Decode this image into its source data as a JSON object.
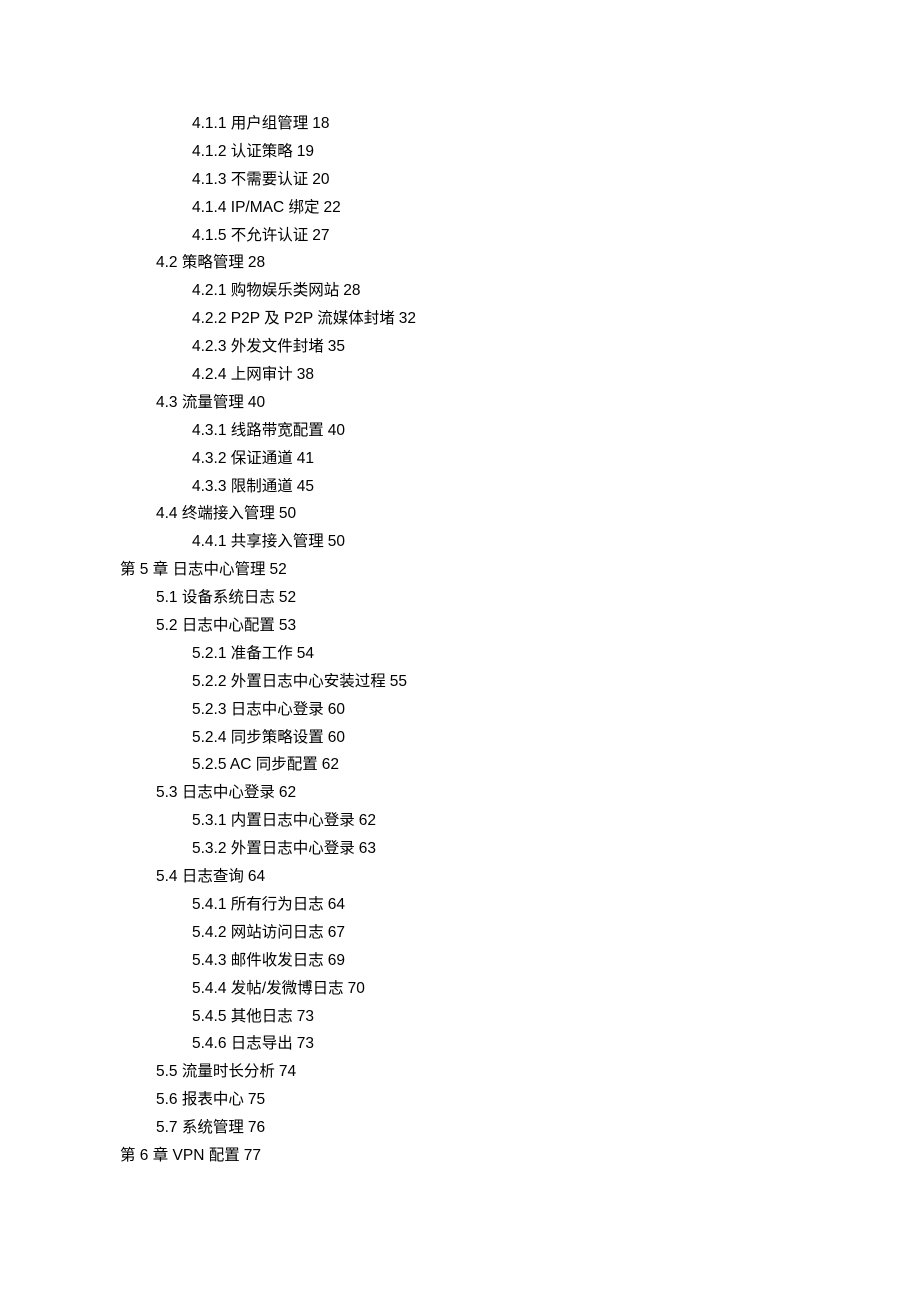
{
  "toc": {
    "entries": [
      {
        "level": 2,
        "label": "4.1.1 用户组管理",
        "page": "18"
      },
      {
        "level": 2,
        "label": "4.1.2 认证策略",
        "page": "19"
      },
      {
        "level": 2,
        "label": "4.1.3 不需要认证",
        "page": "20"
      },
      {
        "level": 2,
        "label": "4.1.4 IP/MAC 绑定",
        "page": "22"
      },
      {
        "level": 2,
        "label": "4.1.5 不允许认证",
        "page": "27"
      },
      {
        "level": 1,
        "label": "4.2 策略管理",
        "page": "28"
      },
      {
        "level": 2,
        "label": "4.2.1 购物娱乐类网站",
        "page": "28"
      },
      {
        "level": 2,
        "label": "4.2.2 P2P 及 P2P 流媒体封堵",
        "page": "32"
      },
      {
        "level": 2,
        "label": "4.2.3 外发文件封堵",
        "page": "35"
      },
      {
        "level": 2,
        "label": "4.2.4 上网审计",
        "page": "38"
      },
      {
        "level": 1,
        "label": "4.3 流量管理",
        "page": "40"
      },
      {
        "level": 2,
        "label": "4.3.1 线路带宽配置",
        "page": "40"
      },
      {
        "level": 2,
        "label": "4.3.2 保证通道",
        "page": "41"
      },
      {
        "level": 2,
        "label": "4.3.3 限制通道",
        "page": "45"
      },
      {
        "level": 1,
        "label": "4.4 终端接入管理",
        "page": "50"
      },
      {
        "level": 2,
        "label": "4.4.1 共享接入管理",
        "page": "50"
      },
      {
        "level": 0,
        "label": "第 5 章 日志中心管理",
        "page": "52"
      },
      {
        "level": 1,
        "label": "5.1 设备系统日志",
        "page": "52"
      },
      {
        "level": 1,
        "label": "5.2 日志中心配置",
        "page": "53"
      },
      {
        "level": 2,
        "label": "5.2.1 准备工作",
        "page": "54"
      },
      {
        "level": 2,
        "label": "5.2.2 外置日志中心安装过程",
        "page": "55"
      },
      {
        "level": 2,
        "label": "5.2.3 日志中心登录",
        "page": "60"
      },
      {
        "level": 2,
        "label": "5.2.4 同步策略设置",
        "page": "60"
      },
      {
        "level": 2,
        "label": "5.2.5 AC 同步配置",
        "page": "62"
      },
      {
        "level": 1,
        "label": "5.3 日志中心登录",
        "page": "62"
      },
      {
        "level": 2,
        "label": "5.3.1 内置日志中心登录",
        "page": "62"
      },
      {
        "level": 2,
        "label": "5.3.2 外置日志中心登录",
        "page": "63"
      },
      {
        "level": 1,
        "label": "5.4 日志查询",
        "page": "64"
      },
      {
        "level": 2,
        "label": "5.4.1 所有行为日志",
        "page": "64"
      },
      {
        "level": 2,
        "label": "5.4.2 网站访问日志",
        "page": "67"
      },
      {
        "level": 2,
        "label": "5.4.3 邮件收发日志",
        "page": "69"
      },
      {
        "level": 2,
        "label": "5.4.4 发帖/发微博日志",
        "page": "70"
      },
      {
        "level": 2,
        "label": "5.4.5 其他日志",
        "page": "73"
      },
      {
        "level": 2,
        "label": "5.4.6 日志导出",
        "page": "73"
      },
      {
        "level": 1,
        "label": "5.5 流量时长分析",
        "page": "74"
      },
      {
        "level": 1,
        "label": "5.6 报表中心",
        "page": "75"
      },
      {
        "level": 1,
        "label": "5.7 系统管理",
        "page": "76"
      },
      {
        "level": 0,
        "label": "第 6 章 VPN 配置",
        "page": "77"
      }
    ]
  }
}
